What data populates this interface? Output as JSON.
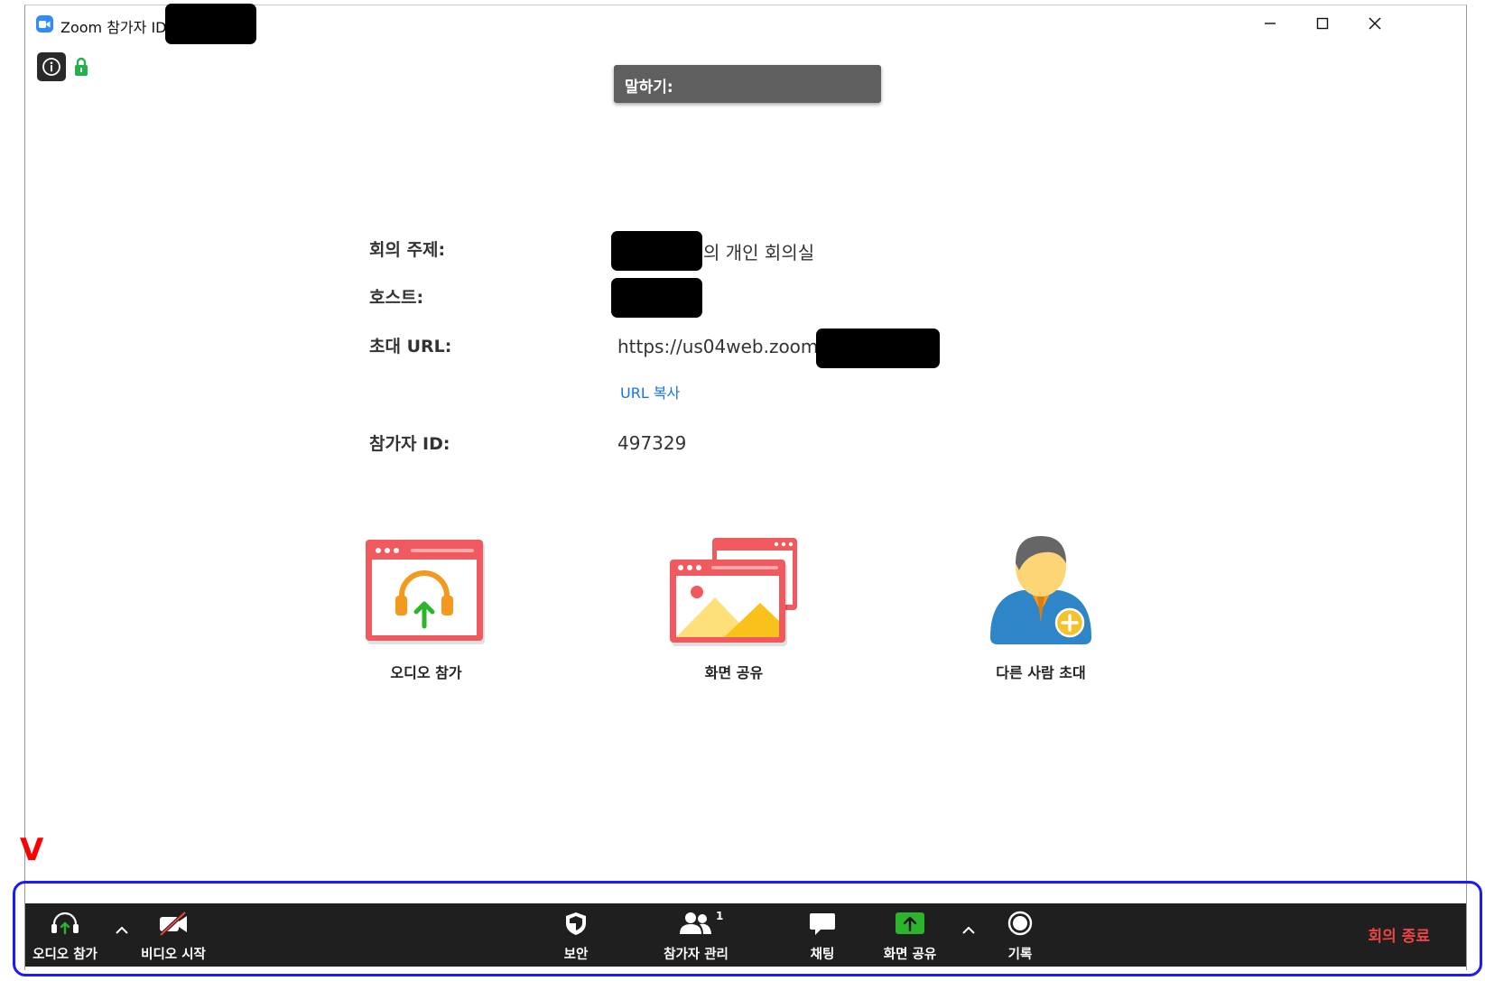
{
  "titlebar": {
    "title": "Zoom 참가자 ID:",
    "minimize": "–",
    "maximize": "☐",
    "close": "✕"
  },
  "speaking": {
    "label": "말하기:"
  },
  "meeting": {
    "topic_label": "회의 주제:",
    "topic_suffix": "의 개인 회의실",
    "host_label": "호스트:",
    "url_label": "초대 URL:",
    "url_value": "https://us04web.zoom.us",
    "copy_url": "URL 복사",
    "participant_id_label": "참가자 ID:",
    "participant_id_value": "497329"
  },
  "actions": {
    "join_audio": "오디오 참가",
    "share_screen": "화면 공유",
    "invite": "다른 사람 초대"
  },
  "toolbar": {
    "join_audio": "오디오 참가",
    "start_video": "비디오 시작",
    "security": "보안",
    "participants": "참가자 관리",
    "participant_count": "1",
    "chat": "채팅",
    "share_screen": "화면 공유",
    "record": "기록",
    "end_meeting": "회의 종료"
  },
  "annotation": {
    "marker": "V"
  },
  "colors": {
    "zoom_blue": "#2d8cff",
    "toolbar_bg": "#1f1f1f",
    "end_red": "#ef4444",
    "share_green": "#2ab52a",
    "highlight_blue": "#1a1aff",
    "card_red": "#f05a5f"
  }
}
